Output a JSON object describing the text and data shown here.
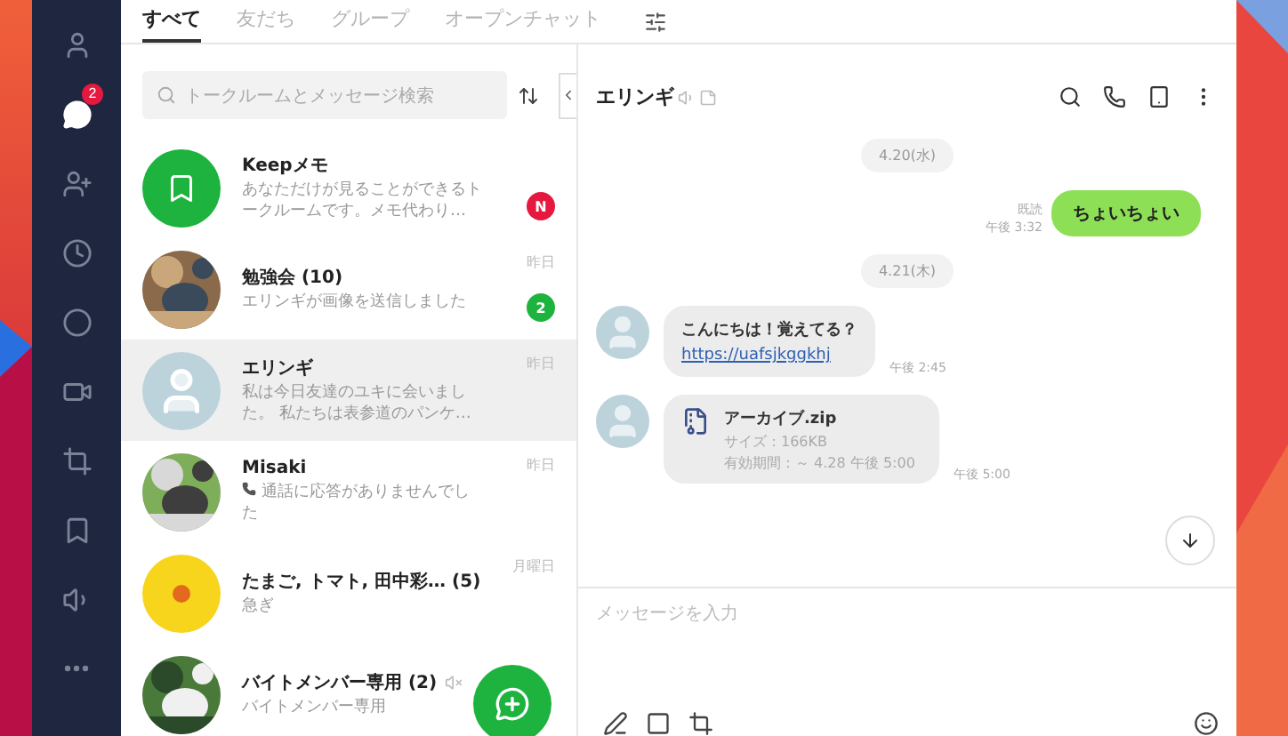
{
  "sidebar": {
    "items": [
      {
        "selected": false
      },
      {
        "selected": true,
        "badge": "2"
      },
      {
        "selected": false
      },
      {
        "selected": false
      },
      {
        "selected": false
      },
      {
        "selected": false
      },
      {
        "selected": false
      },
      {
        "selected": false
      },
      {
        "selected": false
      },
      {
        "selected": false
      }
    ]
  },
  "tabs": [
    {
      "label": "すべて",
      "selected": true
    },
    {
      "label": "友だち",
      "selected": false
    },
    {
      "label": "グループ",
      "selected": false
    },
    {
      "label": "オープンチャット",
      "selected": false
    }
  ],
  "search": {
    "placeholder": "トークルームとメッセージ検索"
  },
  "chats": [
    {
      "name": "Keepメモ",
      "preview": "あなただけが見ることができるトークルームです。メモ代わり…",
      "kind": "keep",
      "badge": {
        "text": "N",
        "kind": "new"
      },
      "selected": false
    },
    {
      "name": "勉強会 (10)",
      "preview": "エリンギが画像を送信しました",
      "time": "昨日",
      "kind": "picture",
      "badge": {
        "text": "2",
        "kind": "count"
      },
      "selected": false
    },
    {
      "name": "エリンギ",
      "preview": "私は今日友達のユキに会いました。 私たちは表参道のパンケ…",
      "time": "昨日",
      "kind": "default",
      "selected": true
    },
    {
      "name": "Misaki",
      "preview": "通話に応答がありませんでした",
      "time": "昨日",
      "kind": "picture",
      "call": true,
      "selected": false
    },
    {
      "name": "たまご, トマト, 田中彩… (5)",
      "preview": "急ぎ",
      "time": "月曜日",
      "kind": "character",
      "selected": false
    },
    {
      "name": "バイトメンバー専用 (2)",
      "preview": "バイトメンバー専用",
      "kind": "picture",
      "muted": true,
      "selected": false
    }
  ],
  "chat": {
    "title": "エリンギ",
    "input_placeholder": "メッセージを入力",
    "messages": [
      {
        "kind": "date",
        "text": "4.20(水)"
      },
      {
        "kind": "sent",
        "text": "ちょいちょい",
        "read": "既読",
        "time": "午後 3:32"
      },
      {
        "kind": "date",
        "text": "4.21(木)"
      },
      {
        "kind": "received",
        "text": "こんにちは！覚えてる？",
        "link": "https://uafsjkggkhj",
        "time": "午後 2:45"
      },
      {
        "kind": "file",
        "file_name": "アーカイブ.zip",
        "size": "サイズ：166KB",
        "expiry": "有効期間：～ 4.28 午後 5:00",
        "time": "午後 5:00"
      }
    ]
  }
}
